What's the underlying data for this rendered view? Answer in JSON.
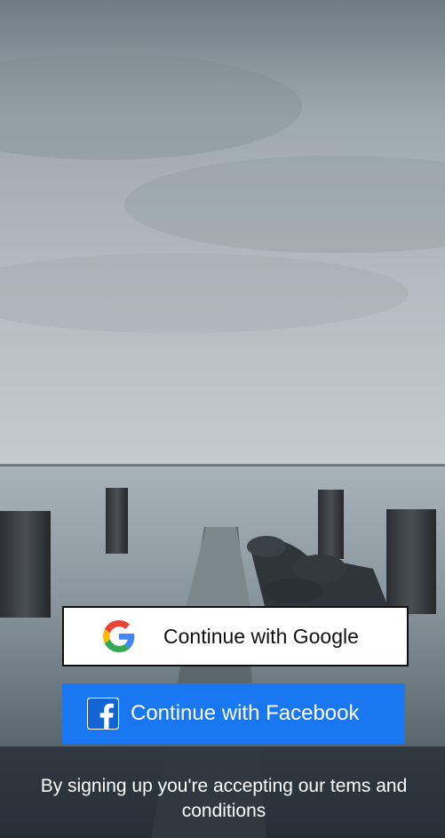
{
  "auth": {
    "google_label": "Continue with Google",
    "facebook_label": "Continue with Facebook"
  },
  "footer": {
    "terms_text": "By signing up you're accepting our tems and conditions"
  },
  "icons": {
    "google": "google-logo-icon",
    "facebook": "facebook-logo-icon"
  },
  "colors": {
    "facebook_blue": "#1977f2",
    "google_blue": "#4285F4",
    "google_red": "#EA4335",
    "google_yellow": "#FBBC05",
    "google_green": "#34A853"
  }
}
